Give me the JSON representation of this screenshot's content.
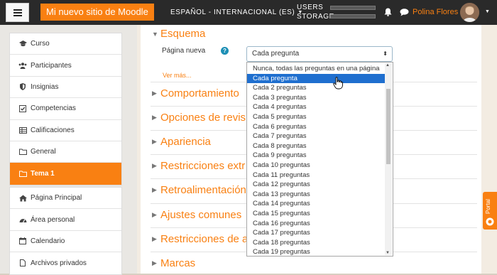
{
  "navbar": {
    "site_title": "Mi nuevo sitio de Moodle",
    "language": "ESPAÑOL - INTERNACIONAL (ES)",
    "usage_users": "USERS",
    "usage_storage": "STORAGE",
    "user_name": "Polina Flores",
    "icons": [
      "hamburger-icon",
      "bell-icon",
      "chat-icon"
    ]
  },
  "sidebar": {
    "course_items": [
      {
        "label": "Curso",
        "icon": "graduation-cap-icon"
      },
      {
        "label": "Participantes",
        "icon": "users-icon"
      },
      {
        "label": "Insignias",
        "icon": "shield-icon"
      },
      {
        "label": "Competencias",
        "icon": "checkbox-icon"
      },
      {
        "label": "Calificaciones",
        "icon": "table-icon"
      },
      {
        "label": "General",
        "icon": "folder-icon"
      },
      {
        "label": "Tema 1",
        "icon": "folder-icon",
        "active": true
      }
    ],
    "site_items": [
      {
        "label": "Página Principal",
        "icon": "home-icon"
      },
      {
        "label": "Área personal",
        "icon": "dashboard-icon"
      },
      {
        "label": "Calendario",
        "icon": "calendar-icon"
      },
      {
        "label": "Archivos privados",
        "icon": "file-icon"
      }
    ]
  },
  "form": {
    "section_title": "Esquema",
    "field_label": "Página nueva",
    "select_value": "Cada pregunta",
    "ver_mas": "Ver más...",
    "collapsed_sections": [
      "Comportamiento",
      "Opciones de revis",
      "Apariencia",
      "Restricciones extr",
      "Retroalimentación",
      "Ajustes comunes",
      "Restricciones de a",
      "Marcas"
    ]
  },
  "dropdown": {
    "selected_index": 1,
    "options": [
      "Nunca, todas las preguntas en una página",
      "Cada pregunta",
      "Cada 2 preguntas",
      "Cada 3 preguntas",
      "Cada 4 preguntas",
      "Cada 5 preguntas",
      "Cada 6 preguntas",
      "Cada 7 preguntas",
      "Cada 8 preguntas",
      "Cada 9 preguntas",
      "Cada 10 preguntas",
      "Cada 11 preguntas",
      "Cada 12 preguntas",
      "Cada 13 preguntas",
      "Cada 14 preguntas",
      "Cada 15 preguntas",
      "Cada 16 preguntas",
      "Cada 17 preguntas",
      "Cada 18 preguntas",
      "Cada 19 preguntas"
    ]
  },
  "portal_tab": {
    "label": "Portal"
  },
  "colors": {
    "accent": "#f98012",
    "navbar": "#2a2a2a",
    "selection": "#1f6fcf",
    "help": "#1d8fb5"
  }
}
